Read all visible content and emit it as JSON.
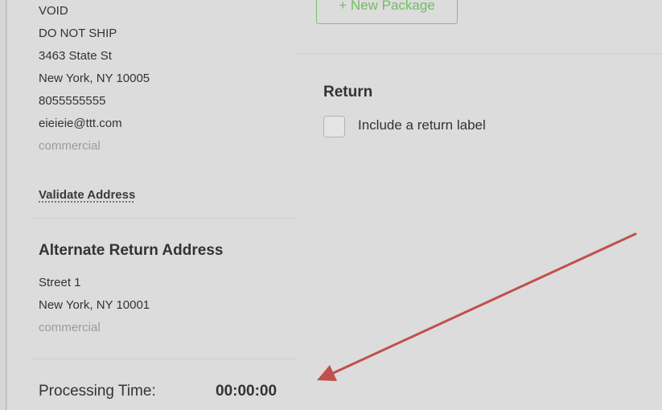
{
  "ship_to": {
    "lines": [
      "VOID",
      "DO NOT SHIP",
      "3463 State St",
      "New York, NY 10005",
      "8055555555",
      "eieieie@ttt.com"
    ],
    "type": "commercial",
    "validate_label": "Validate Address"
  },
  "alternate_return": {
    "title": "Alternate Return Address",
    "lines": [
      "Street 1",
      "New York, NY 10001"
    ],
    "type": "commercial"
  },
  "processing": {
    "label": "Processing Time:",
    "value": "00:00:00"
  },
  "packages": {
    "new_package_label": "+ New Package"
  },
  "return_section": {
    "title": "Return",
    "checkbox_label": "Include a return label",
    "checked": false
  },
  "colors": {
    "accent_green": "#6fbf5f",
    "annotation_arrow": "#c0504d"
  }
}
